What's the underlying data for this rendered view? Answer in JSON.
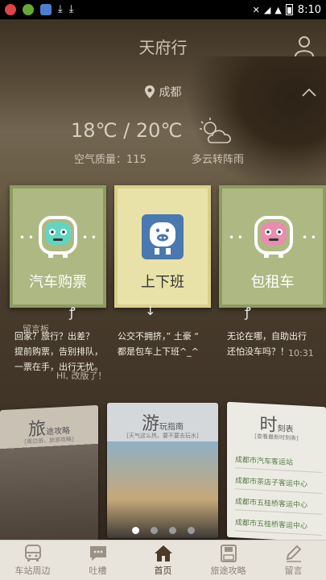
{
  "status_bar": {
    "time": "8:10"
  },
  "header": {
    "title": "天府行"
  },
  "weather": {
    "city": "成都",
    "temperature": "18℃ / 20℃",
    "air_quality": "空气质量：115",
    "description": "多云转阵雨"
  },
  "cards": [
    {
      "label": "汽车购票",
      "icon": "bus-icon",
      "color": "#aeb882"
    },
    {
      "label": "上下班",
      "icon": "pig-bus-icon",
      "color": "#e9e2a8"
    },
    {
      "label": "包租车",
      "icon": "pink-bus-icon",
      "color": "#aeb882"
    }
  ],
  "descriptions": [
    {
      "lines": [
        "回家？旅行？出差？",
        "提前购票，告别排队，",
        "一票在手，出行无忧。"
      ]
    },
    {
      "lines": [
        "公交不拥挤，”  土豪 “",
        "都是包车上下班^_^"
      ]
    },
    {
      "lines": [
        "无论在哪，自助出行",
        "还怕没车吗？！"
      ]
    }
  ],
  "background_text": {
    "message_label": "留言板",
    "message": "HI, 改版了！",
    "time": "10:31"
  },
  "guides": [
    {
      "title": "旅",
      "title_small": "途攻略",
      "subtitle": "[周边游，旅游攻略]"
    },
    {
      "title": "游",
      "title_small": "玩指南",
      "subtitle": "[天气这么热，要不要去玩水]"
    },
    {
      "title": "时",
      "title_small": "刻表",
      "subtitle": "[查看最新时刻表]",
      "stations": [
        "成都市汽车客运站",
        "成都市茶店子客运中心",
        "成都市五桂桥客运中心",
        "成都市五桂桥客运中心"
      ]
    }
  ],
  "pager": {
    "count": 4,
    "active": 1
  },
  "nav": [
    {
      "label": "车站周边",
      "icon": "bus-front-icon"
    },
    {
      "label": "吐槽",
      "icon": "chat-bubble-icon"
    },
    {
      "label": "首页",
      "icon": "home-icon",
      "active": true
    },
    {
      "label": "旅途攻略",
      "icon": "save-disk-icon"
    },
    {
      "label": "留言",
      "icon": "pencil-icon"
    }
  ]
}
